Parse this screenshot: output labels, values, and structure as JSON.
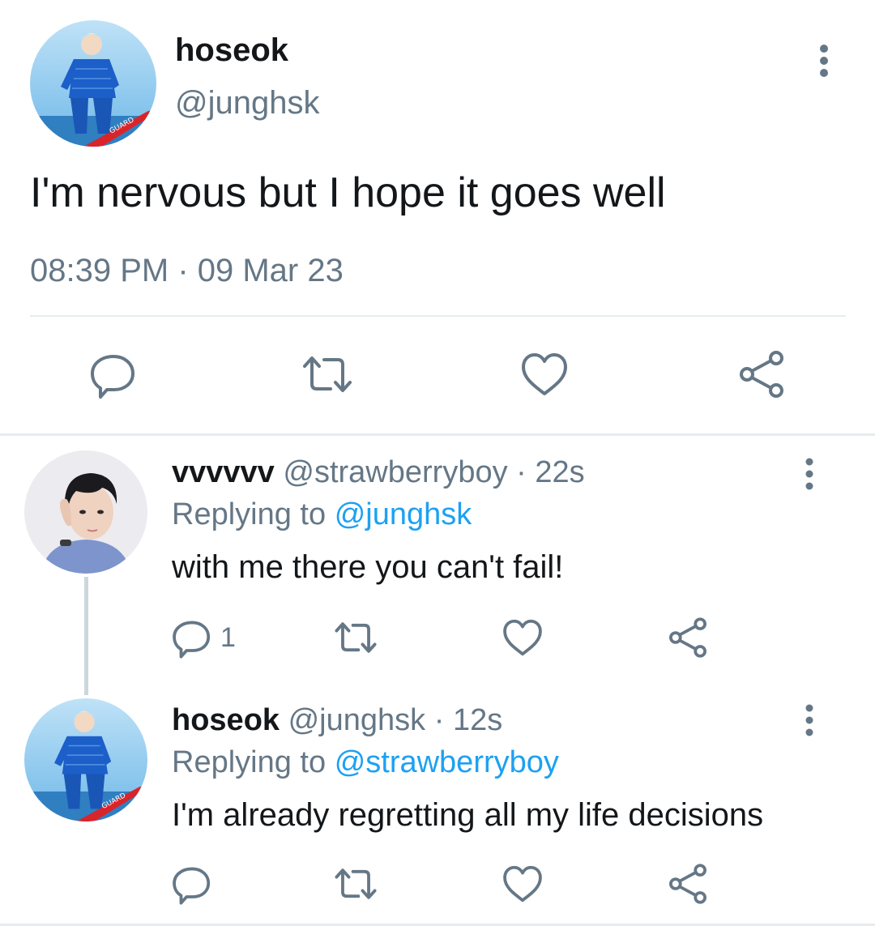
{
  "main_tweet": {
    "name": "hoseok",
    "handle": "@junghsk",
    "text": "I'm nervous but I hope it goes well",
    "timestamp": "08:39 PM · 09 Mar 23",
    "avatar_text": "GUARD",
    "actions": [
      "reply-icon",
      "retweet-icon",
      "like-icon",
      "share-icon"
    ]
  },
  "replies": [
    {
      "name": "vvvvvv",
      "handle": "@strawberryboy",
      "time": "· 22s",
      "replying_label": "Replying to",
      "replying_to": "@junghsk",
      "text": "with me there you can't fail!",
      "reply_count": "1"
    },
    {
      "name": "hoseok",
      "handle": "@junghsk",
      "time": "· 12s",
      "replying_label": "Replying to",
      "replying_to": "@strawberryboy",
      "text": "I'm already regretting all my life decisions",
      "avatar_text": "GUARD"
    }
  ],
  "colors": {
    "text": "#14171a",
    "secondary": "#657786",
    "link": "#1da1f2",
    "divider": "#e6ecf0"
  }
}
